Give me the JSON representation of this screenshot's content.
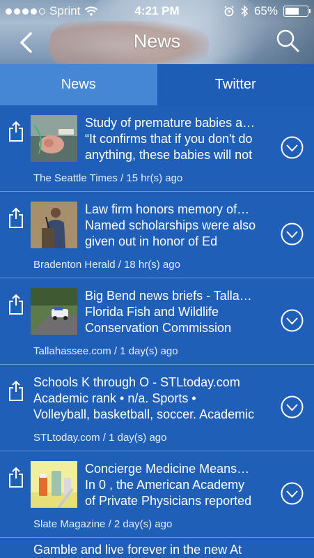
{
  "status_bar": {
    "carrier": "Sprint",
    "time": "4:21 PM",
    "battery": "65%",
    "battery_level": 0.65
  },
  "nav": {
    "title": "News"
  },
  "tabs": [
    {
      "label": "News",
      "active": true
    },
    {
      "label": "Twitter",
      "active": false
    }
  ],
  "articles": [
    {
      "title": "Study of premature babies a…",
      "snippet": [
        "“It confirms that if you don't do",
        "anything, these babies will not"
      ],
      "source": "The Seattle Times",
      "age": "/ 15 hr(s) ago",
      "thumbnail": "premature-baby-photo"
    },
    {
      "title": "Law firm honors memory of…",
      "snippet": [
        "Named scholarships were also",
        "given out in honor of Ed"
      ],
      "source": "Bradenton Herald",
      "age": "/ 18 hr(s) ago",
      "thumbnail": "speaker-at-podium-photo"
    },
    {
      "title": "Big Bend news briefs - Talla…",
      "snippet": [
        "Florida Fish and Wildlife",
        "Conservation Commission"
      ],
      "source": "Tallahassee.com",
      "age": "/ 1 day(s) ago",
      "thumbnail": "police-car-street-photo"
    },
    {
      "title": "Schools K through O - STLtoday.com",
      "snippet": [
        "Academic rank • n/a. Sports •",
        "Volleyball, basketball, soccer. Academic"
      ],
      "source": "STLtoday.com",
      "age": "/ 1 day(s) ago",
      "thumbnail": null
    },
    {
      "title": "Concierge Medicine Means…",
      "snippet": [
        "In 0 , the American Academy",
        "of Private Physicians reported"
      ],
      "source": "Slate Magazine",
      "age": "/ 2 day(s) ago",
      "thumbnail": "medicine-bottles-photo"
    },
    {
      "title": "Gamble and live forever in the new At",
      "snippet": [],
      "source": "",
      "age": "",
      "thumbnail": null
    }
  ],
  "colors": {
    "list_background": "#1f5fb8",
    "active_tab": "#4587d5",
    "inactive_tab": "#1e5db5"
  }
}
